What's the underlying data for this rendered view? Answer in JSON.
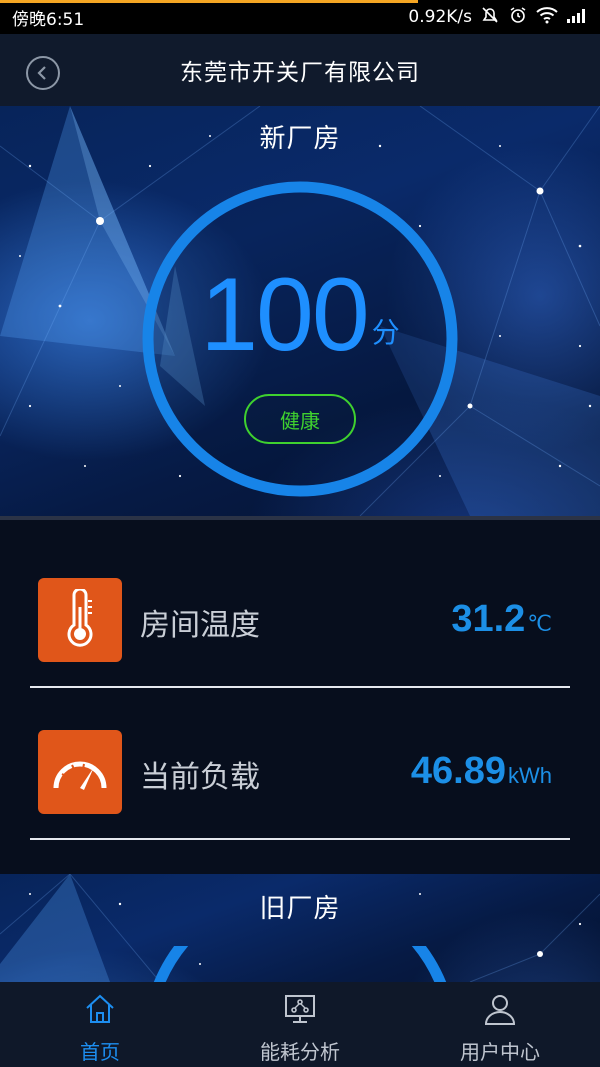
{
  "status_bar": {
    "time": "傍晚6:51",
    "network_speed": "0.92K/s"
  },
  "header": {
    "title": "东莞市开关厂有限公司",
    "back_icon": "chevron-left-circle-icon"
  },
  "new_plant": {
    "title": "新厂房",
    "score": "100",
    "score_unit": "分",
    "score_fraction": 1.0,
    "status": "健康"
  },
  "metrics": [
    {
      "label": "房间温度",
      "value": "31.2",
      "unit": "℃",
      "icon": "thermometer-icon"
    },
    {
      "label": "当前负载",
      "value": "46.89",
      "unit": "kWh",
      "icon": "gauge-icon"
    }
  ],
  "old_plant": {
    "title": "旧厂房"
  },
  "bottom_nav": [
    {
      "label": "首页",
      "icon": "home-icon",
      "active": true
    },
    {
      "label": "能耗分析",
      "icon": "energy-analysis-icon",
      "active": false
    },
    {
      "label": "用户中心",
      "icon": "user-icon",
      "active": false
    }
  ],
  "colors": {
    "accent": "#1d8ef0",
    "health": "#3fd12f",
    "metric_icon_bg": "#e0561a"
  }
}
